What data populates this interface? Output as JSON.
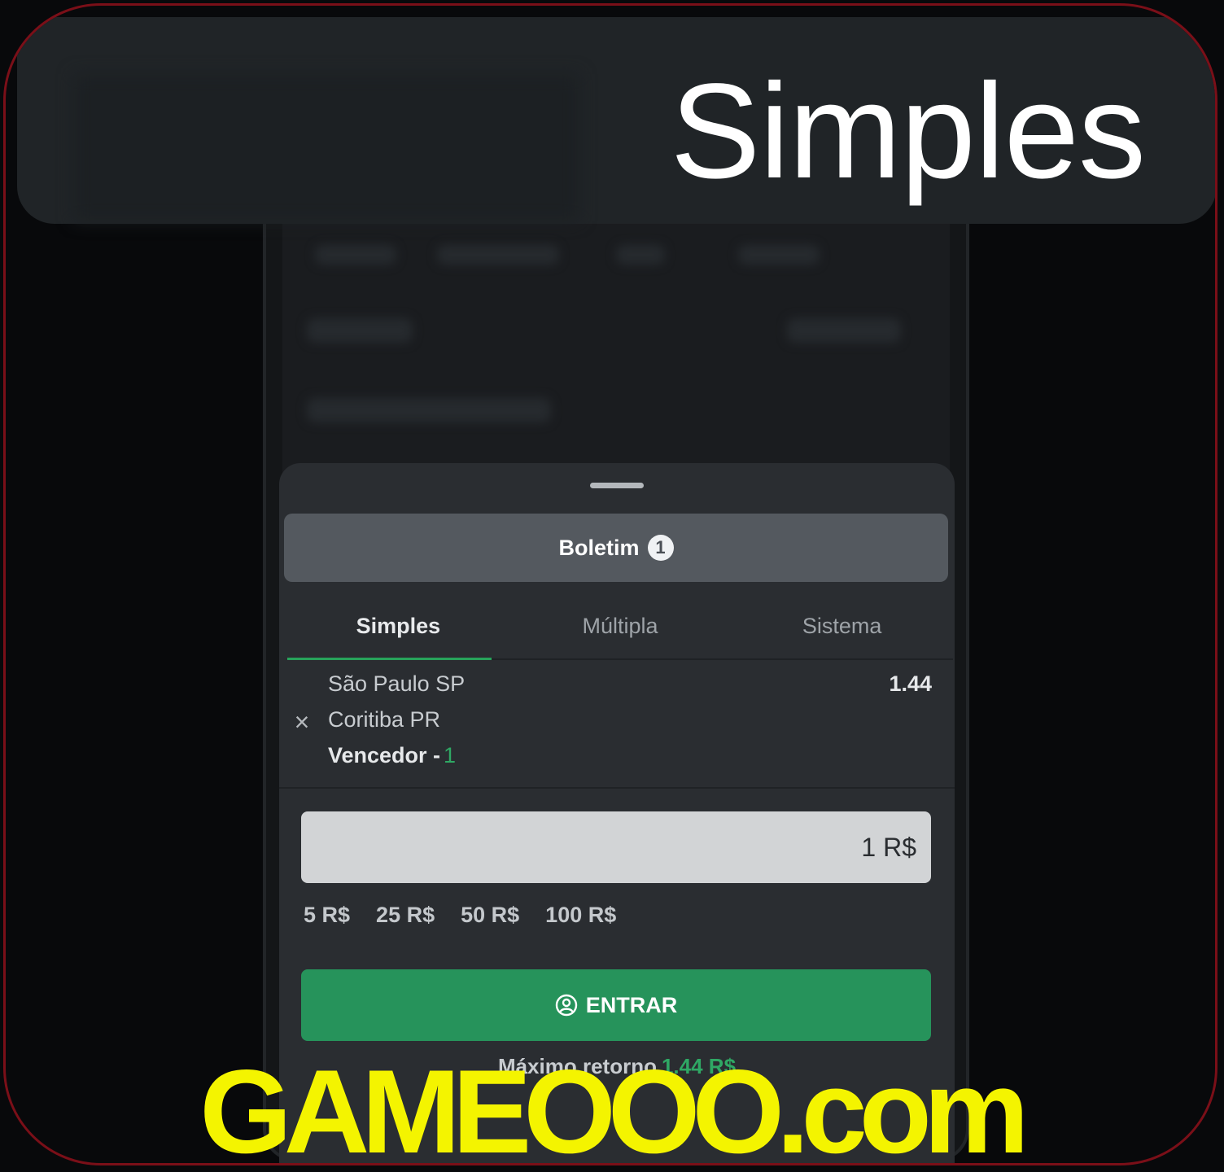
{
  "header": {
    "title": "Simples"
  },
  "betslip": {
    "title": "Boletim",
    "count": "1",
    "tabs": [
      {
        "label": "Simples",
        "active": true
      },
      {
        "label": "Múltipla",
        "active": false
      },
      {
        "label": "Sistema",
        "active": false
      }
    ],
    "bet": {
      "home_team": "São Paulo SP",
      "away_team": "Coritiba PR",
      "market": "Vencedor -",
      "selection": "1",
      "odds": "1.44"
    },
    "stake_value": "1 R$",
    "quick_amounts": [
      "5 R$",
      "25 R$",
      "50 R$",
      "100 R$"
    ],
    "enter_label": "ENTRAR",
    "max_return_label": "Máximo retorno",
    "max_return_value": "1.44 R$"
  },
  "watermark": "GAMEOOO.com",
  "colors": {
    "accent_green": "#26935b",
    "odds_green": "#2fa864",
    "frame_red": "#7a0f18",
    "watermark_yellow": "#f4f400"
  },
  "icons": [
    "close-icon",
    "user-circle-icon"
  ]
}
